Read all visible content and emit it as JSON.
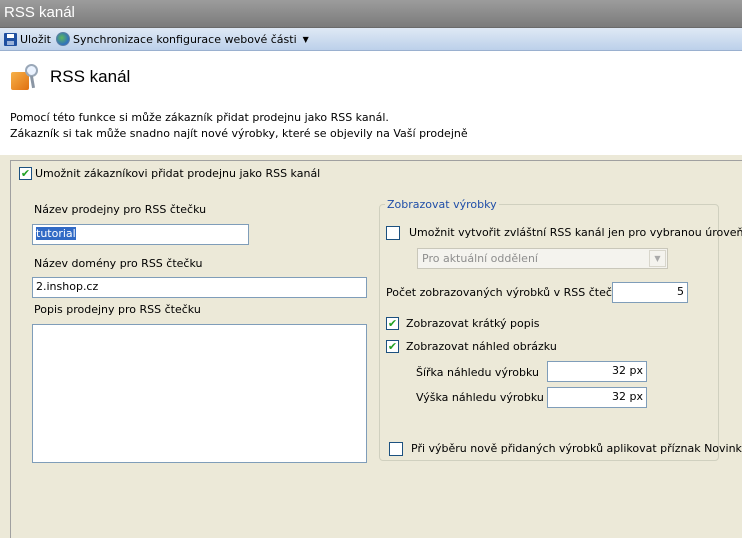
{
  "window": {
    "title": "RSS kanál"
  },
  "toolbar": {
    "save_label": "Uložit",
    "sync_label": "Synchronizace konfigurace webové části",
    "save_icon": "floppy-disk-icon",
    "sync_icon": "sync-globe-icon",
    "dropdown_icon": "caret-down-icon"
  },
  "header": {
    "title": "RSS kanál",
    "icon": "rss-feed-icon",
    "description_line1": "Pomocí této funkce si může zákazník přidat prodejnu jako RSS kanál.",
    "description_line2": " Zákazník si tak může snadno najít nové výrobky, které se objevily na Vaší prodejně"
  },
  "form": {
    "allow_rss": {
      "label": "Umožnit zákazníkovi přidat prodejnu jako RSS kanál",
      "checked": true
    },
    "shop_name": {
      "label": "Název prodejny pro RSS čtečku",
      "value": "tutorial"
    },
    "domain_name": {
      "label": "Název domény pro RSS čtečku",
      "value": "2.inshop.cz"
    },
    "shop_description": {
      "label": "Popis prodejny pro RSS čtečku",
      "value": ""
    }
  },
  "products_group": {
    "legend": "Zobrazovat výrobky",
    "special_channel": {
      "label": "Umožnit vytvořit zvláštní RSS kanál jen pro vybranou úroveň",
      "checked": false
    },
    "level_select": {
      "value": "Pro aktuální oddělení",
      "disabled": true
    },
    "count": {
      "label": "Počet zobrazovaných výrobků v RSS čtečce",
      "value": "5"
    },
    "show_short_desc": {
      "label": "Zobrazovat krátký popis",
      "checked": true
    },
    "show_thumbnail": {
      "label": "Zobrazovat náhled obrázku",
      "checked": true
    },
    "thumb_width": {
      "label": "Šířka náhledu výrobku",
      "value": "32 px"
    },
    "thumb_height": {
      "label": "Výška náhledu výrobku",
      "value": "32 px"
    },
    "new_flag": {
      "label": "Při výběru nově přidaných výrobků aplikovat příznak Novinka",
      "checked": false
    }
  },
  "colors": {
    "accent": "#316ac5",
    "group_legend": "#1f4ea8",
    "check": "#21a121"
  }
}
